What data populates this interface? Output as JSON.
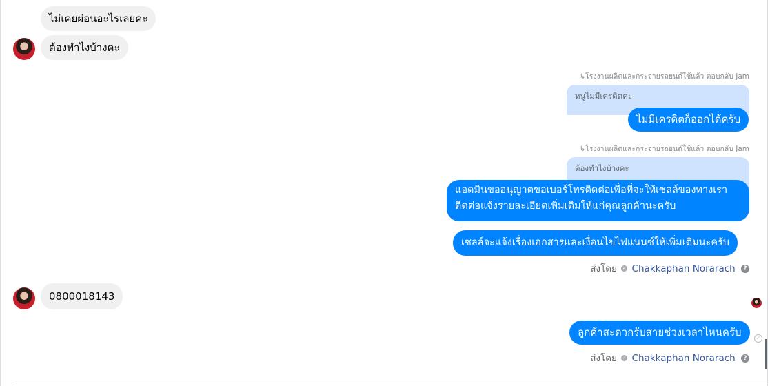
{
  "messages": {
    "in_1": "ไม่เคยผ่อนอะไรเลยค่ะ",
    "in_2": "ต้องทำไงบ้างคะ",
    "reply_1": {
      "meta": "โรงงานผลิตและกระจายรถยนต์ใช้แล้ว ตอบกลับ Jam",
      "quoted": "หนูไม่มีเครดิตค่ะ",
      "text": "ไม่มีเครดิตก็ออกได้ครับ"
    },
    "reply_2": {
      "meta": "โรงงานผลิตและกระจายรถยนต์ใช้แล้ว ตอบกลับ Jam",
      "quoted": "ต้องทำไงบ้างคะ",
      "text_line1": "แอดมินขออนุญาตขอเบอร์โทรติดต่อเพื่อที่จะให้เซลล์ของทางเรา",
      "text_line2": "ติดต่อแจ้งรายละเอียดเพิ่มเติมให้แก่คุณลูกค้านะครับ"
    },
    "out_3": "เซลล์จะแจ้งเรื่องเอกสารและเงื่อนไขไฟแนนซ์ให้เพิ่มเติมนะครับ",
    "in_3": "0800018143",
    "out_4": "ลูกค้าสะดวกรับสายช่วงเวลาไหนครับ"
  },
  "sent_by": {
    "label": "ส่งโดย",
    "name": "Chakkaphan Norarach"
  },
  "icons": {
    "reply_arrow": "↳",
    "verified": "✓",
    "help": "?",
    "read_check": "✓"
  },
  "colors": {
    "outgoing_bubble": "#0084ff",
    "incoming_bubble": "#f0f0f0",
    "reply_preview": "#cfe3fe",
    "sender_link": "#385898"
  }
}
